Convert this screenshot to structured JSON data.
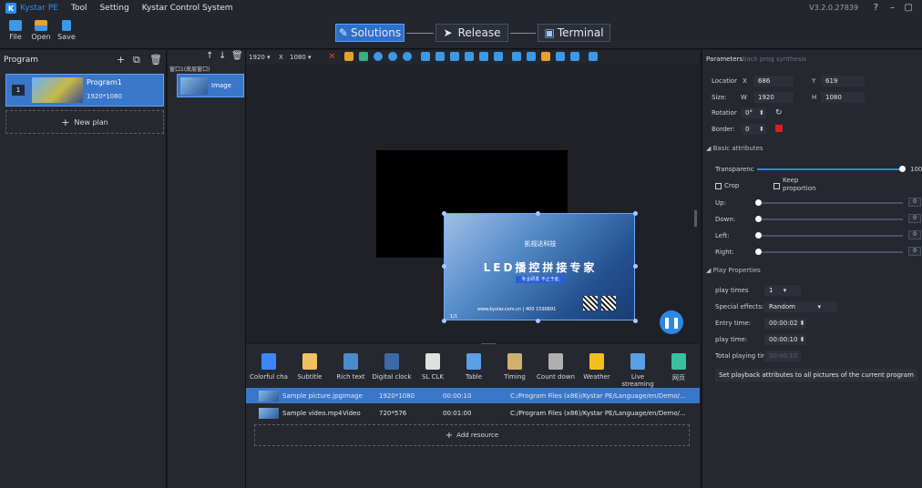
{
  "menu": {
    "app_name": "Kystar PE",
    "items": [
      "Tool",
      "Setting",
      "Kystar Control System"
    ],
    "version": "V3.2.0.27839"
  },
  "toolbar": {
    "file": "File",
    "open": "Open",
    "save": "Save"
  },
  "modes": {
    "solutions": "Solutions",
    "release": "Release",
    "terminal": "Terminal"
  },
  "program_panel": {
    "title": "Program",
    "program_number": "1",
    "program_name": "Program1",
    "program_resolution": "1920*1080",
    "new_plan": "New plan"
  },
  "layer_panel": {
    "group_label": "窗口1(底层窗口)",
    "item_label": "Image"
  },
  "edit_toolbar": {
    "width": "1920",
    "x_label": "X",
    "height": "1080"
  },
  "media": {
    "company": "凯视达科技",
    "headline": "LED播控拼接专家",
    "tagline": "专业研发 不止于此",
    "url": "www.kystar.com.cn",
    "phone": "400 1590891",
    "page": "1/1"
  },
  "resource_types": [
    {
      "label": "Colorful cha",
      "icon": "colorful-text-icon",
      "color": "#3a86ff"
    },
    {
      "label": "Subtitle",
      "icon": "subtitle-icon",
      "color": "#f0c060"
    },
    {
      "label": "Rich text",
      "icon": "rich-text-icon",
      "color": "#4a8ad0"
    },
    {
      "label": "Digital clock",
      "icon": "digital-clock-icon",
      "color": "#3a6aa8"
    },
    {
      "label": "SL CLK",
      "icon": "clock-icon",
      "color": "#e0e0e0"
    },
    {
      "label": "Table",
      "icon": "table-icon",
      "color": "#5aa0e6"
    },
    {
      "label": "Timing",
      "icon": "timing-icon",
      "color": "#d0b070"
    },
    {
      "label": "Count down",
      "icon": "countdown-icon",
      "color": "#b0b0b0"
    },
    {
      "label": "Weather",
      "icon": "weather-icon",
      "color": "#f0c020"
    },
    {
      "label": "Live streaming",
      "icon": "live-streaming-icon",
      "color": "#5aa0e6"
    },
    {
      "label": "网页",
      "icon": "web-icon",
      "color": "#3ac0a0"
    }
  ],
  "resources": [
    {
      "name": "Sample picture.jpg",
      "type": "Image",
      "size": "1920*1080",
      "duration": "00:00:10",
      "path": "C:/Program Files (x86)/Kystar PE/Language/en/Demo/..."
    },
    {
      "name": "Sample video.mp4",
      "type": "Video",
      "size": "720*576",
      "duration": "00:01:00",
      "path": "C:/Program Files (x86)/Kystar PE/Language/en/Demo/..."
    }
  ],
  "add_resource": "Add resource",
  "properties": {
    "tabs": "Parameters",
    "tab_rest": "back prog synthesis",
    "location_label": "Locatior",
    "x_label": "X",
    "x_value": "686",
    "y_label": "Y",
    "y_value": "619",
    "size_label": "Size:",
    "w_label": "W",
    "w_value": "1920",
    "h_label": "H",
    "h_value": "1080",
    "rotation_label": "Rotatior",
    "rotation_value": "0°",
    "border_label": "Border:",
    "border_value": "0",
    "basic_attributes": "Basic attributes",
    "transparency_label": "Transparenc",
    "transparency_value": "100",
    "crop_label": "Crop",
    "keep_label": "Keep",
    "proportion_label": "proportion",
    "up_label": "Up:",
    "down_label": "Down:",
    "left_label": "Left:",
    "right_label": "Right:",
    "slider_value": "0",
    "play_properties": "Play Properties",
    "play_times_label": "play times",
    "play_times_value": "1",
    "special_effects_label": "Special effects:",
    "special_effects_value": "Random",
    "entry_time_label": "Entry time:",
    "entry_time_value": "00:00:02",
    "play_time_label": "play time:",
    "play_time_value": "00:00:10",
    "total_playing_label": "Total playing tir",
    "total_playing_value": "00:00:10",
    "apply_button": "Set playback attributes to all pictures of the current program"
  },
  "colors": {
    "accent": "#2f6fc9",
    "border_color": "#e21c1c"
  }
}
